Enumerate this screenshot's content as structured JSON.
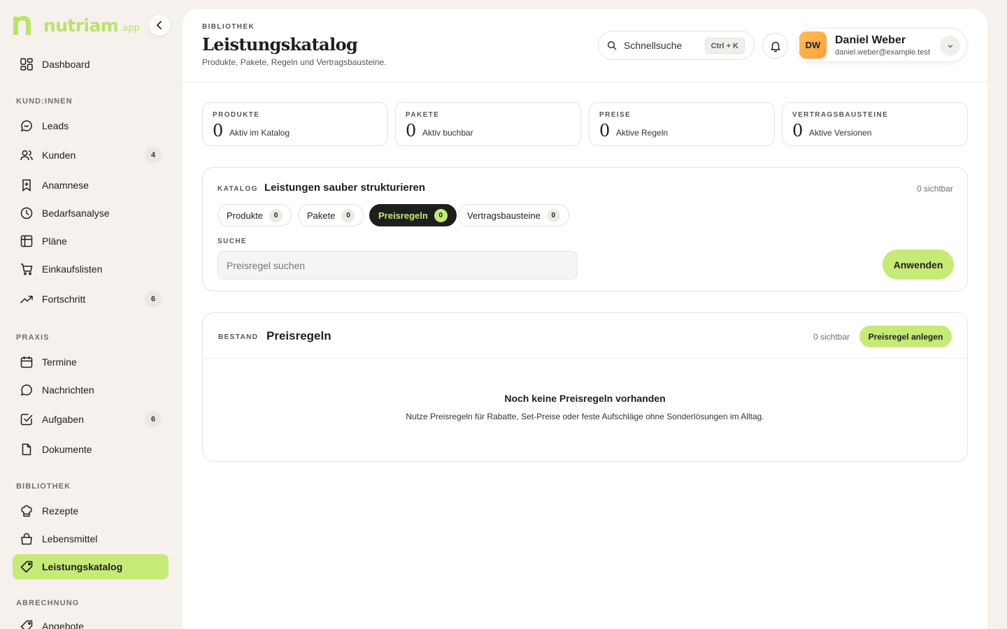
{
  "brand": {
    "name": "nutriam",
    "tld": ".app",
    "accent": "#c6ea76",
    "logo_color": "#b9e36a"
  },
  "sidebar": {
    "collapse_icon": "chevron-left-icon",
    "items_top": [
      {
        "label": "Dashboard",
        "icon": "grid-icon"
      }
    ],
    "section_customers": "KUND:INNEN",
    "customers": [
      {
        "label": "Leads",
        "icon": "chat-icon"
      },
      {
        "label": "Kunden",
        "icon": "users-icon",
        "badge": "4"
      },
      {
        "label": "Anamnese",
        "icon": "bookmark-icon"
      },
      {
        "label": "Bedarfsanalyse",
        "icon": "clock-icon"
      },
      {
        "label": "Pläne",
        "icon": "table-icon"
      },
      {
        "label": "Einkaufslisten",
        "icon": "cart-icon"
      },
      {
        "label": "Fortschritt",
        "icon": "trend-icon",
        "badge": "6"
      }
    ],
    "section_practice": "PRAXIS",
    "practice": [
      {
        "label": "Termine",
        "icon": "calendar-icon"
      },
      {
        "label": "Nachrichten",
        "icon": "message-icon"
      },
      {
        "label": "Aufgaben",
        "icon": "checkbox-icon",
        "badge": "6"
      },
      {
        "label": "Dokumente",
        "icon": "document-icon"
      }
    ],
    "section_library": "BIBLIOTHEK",
    "library": [
      {
        "label": "Rezepte",
        "icon": "chef-hat-icon"
      },
      {
        "label": "Lebensmittel",
        "icon": "basket-icon"
      },
      {
        "label": "Leistungskatalog",
        "icon": "tag-icon",
        "active": true
      }
    ],
    "section_billing": "ABRECHNUNG",
    "billing": [
      {
        "label": "Angebote",
        "icon": "tag-icon"
      }
    ]
  },
  "header": {
    "eyebrow": "BIBLIOTHEK",
    "title": "Leistungskatalog",
    "subtitle": "Produkte, Pakete, Regeln und Vertragsbausteine.",
    "search_label": "Schnellsuche",
    "shortcut": "Ctrl + K",
    "user": {
      "initials": "DW",
      "name": "Daniel Weber",
      "email": "daniel.weber@example.test"
    }
  },
  "stats": [
    {
      "eyebrow": "PRODUKTE",
      "value": "0",
      "label": "Aktiv im Katalog"
    },
    {
      "eyebrow": "PAKETE",
      "value": "0",
      "label": "Aktiv buchbar"
    },
    {
      "eyebrow": "PREISE",
      "value": "0",
      "label": "Aktive Regeln"
    },
    {
      "eyebrow": "VERTRAGSBAUSTEINE",
      "value": "0",
      "label": "Aktive Versionen"
    }
  ],
  "catalog": {
    "eyebrow": "KATALOG",
    "title": "Leistungen sauber strukturieren",
    "visible": "0 sichtbar",
    "tabs": [
      {
        "label": "Produkte",
        "count": "0"
      },
      {
        "label": "Pakete",
        "count": "0"
      },
      {
        "label": "Preisregeln",
        "count": "0",
        "active": true
      },
      {
        "label": "Vertragsbausteine",
        "count": "0"
      }
    ],
    "search_label": "SUCHE",
    "search_placeholder": "Preisregel suchen",
    "apply": "Anwenden"
  },
  "inventory": {
    "eyebrow": "BESTAND",
    "title": "Preisregeln",
    "visible": "0 sichtbar",
    "create": "Preisregel anlegen",
    "empty_title": "Noch keine Preisregeln vorhanden",
    "empty_text": "Nutze Preisregeln für Rabatte, Set-Preise oder feste Aufschläge ohne Sonderlösungen im Alltag."
  }
}
